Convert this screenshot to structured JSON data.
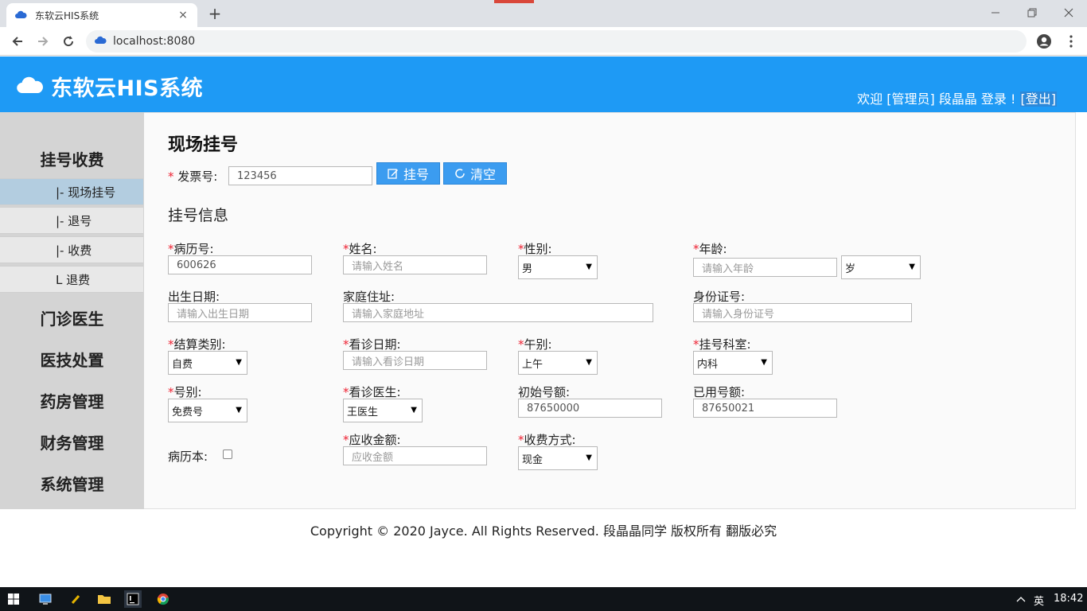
{
  "browser": {
    "tab_title": "东软云HIS系统",
    "close_glyph": "×",
    "new_tab_glyph": "+",
    "url": "localhost:8080"
  },
  "header": {
    "title": "东软云HIS系统",
    "welcome": "欢迎 [管理员] 段晶晶 登录 !",
    "logout": "[登出]"
  },
  "sidebar": {
    "groups": [
      {
        "label": "挂号收费"
      },
      {
        "label": "门诊医生"
      },
      {
        "label": "医技处置"
      },
      {
        "label": "药房管理"
      },
      {
        "label": "财务管理"
      },
      {
        "label": "系统管理"
      }
    ],
    "subitems": [
      {
        "label": "|- 现场挂号",
        "active": true
      },
      {
        "label": "|- 退号",
        "active": false
      },
      {
        "label": "|- 收费",
        "active": false
      },
      {
        "label": "L 退费",
        "active": false
      }
    ]
  },
  "page": {
    "title": "现场挂号",
    "invoice_label": "发票号:",
    "invoice_value": "123456",
    "register_button": "挂号",
    "clear_button": "清空",
    "section_title": "挂号信息"
  },
  "form": {
    "record_no": {
      "label": "病历号:",
      "value": "600626"
    },
    "name": {
      "label": "姓名:",
      "placeholder": "请输入姓名"
    },
    "gender": {
      "label": "性别:",
      "value": "男"
    },
    "age": {
      "label": "年龄:",
      "placeholder": "请输入年龄",
      "unit": "岁"
    },
    "birthday": {
      "label": "出生日期:",
      "placeholder": "请输入出生日期"
    },
    "address": {
      "label": "家庭住址:",
      "placeholder": "请输入家庭地址"
    },
    "id_card": {
      "label": "身份证号:",
      "placeholder": "请输入身份证号"
    },
    "settle_type": {
      "label": "结算类别:",
      "value": "自费"
    },
    "visit_date": {
      "label": "看诊日期:",
      "placeholder": "请输入看诊日期"
    },
    "noon": {
      "label": "午别:",
      "value": "上午"
    },
    "dept": {
      "label": "挂号科室:",
      "value": "内科"
    },
    "level": {
      "label": "号别:",
      "value": "免费号"
    },
    "doctor": {
      "label": "看诊医生:",
      "value": "王医生"
    },
    "init_quota": {
      "label": "初始号额:",
      "value": "87650000"
    },
    "used_quota": {
      "label": "已用号额:",
      "value": "87650021"
    },
    "record_book": {
      "label": "病历本:"
    },
    "amount": {
      "label": "应收金额:",
      "placeholder": "应收金额"
    },
    "pay_method": {
      "label": "收费方式:",
      "value": "现金"
    }
  },
  "footer": {
    "text": "Copyright © 2020 Jayce. All Rights Reserved. 段晶晶同学 版权所有 翻版必究"
  },
  "taskbar": {
    "ime": "英",
    "clock": "18:42"
  },
  "colors": {
    "header_bg": "#1e9af5",
    "button_bg": "#3b9cf0",
    "required": "#e23",
    "active_menu": "#b3cde0"
  }
}
